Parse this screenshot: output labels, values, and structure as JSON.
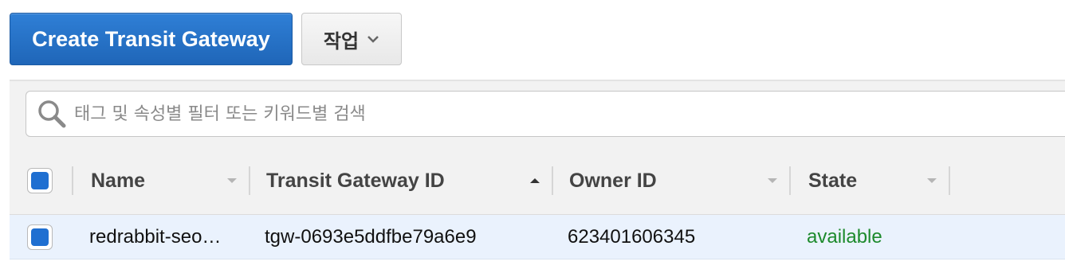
{
  "toolbar": {
    "create_label": "Create Transit Gateway",
    "actions_label": "작업"
  },
  "search": {
    "placeholder": "태그 및 속성별 필터 또는 키워드별 검색",
    "value": ""
  },
  "table": {
    "columns": [
      "Name",
      "Transit Gateway ID",
      "Owner ID",
      "State"
    ],
    "rows": [
      {
        "name": "redrabbit-seo…",
        "transit_gateway_id": "tgw-0693e5ddfbe79a6e9",
        "owner_id": "623401606345",
        "state": "available"
      }
    ]
  },
  "colors": {
    "primary": "#1f6fd1",
    "state_available": "#1d8a2c"
  },
  "icons": [
    "search-icon",
    "chevron-down-icon",
    "sort-down-icon",
    "sort-up-icon"
  ]
}
